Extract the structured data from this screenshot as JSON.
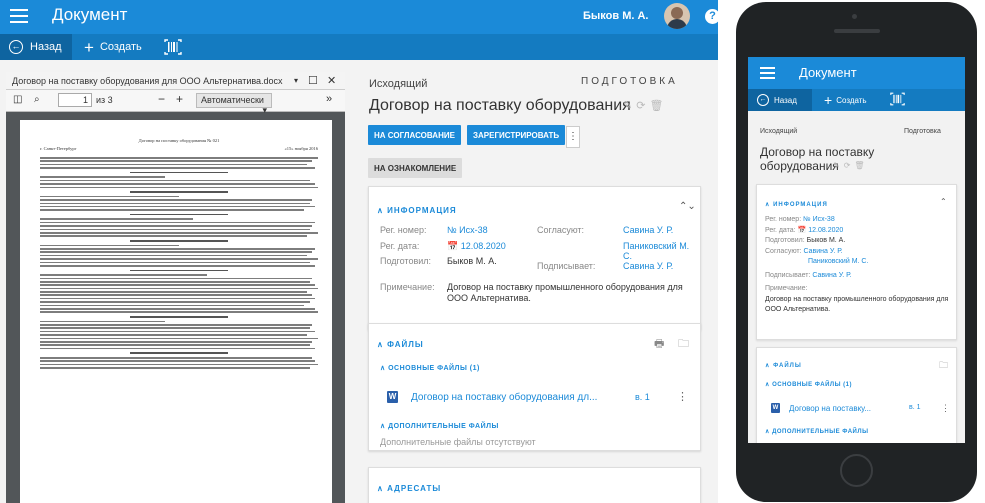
{
  "header": {
    "app_title": "Документ",
    "user_name": "Быков М. А.",
    "help_label": "?"
  },
  "toolbar": {
    "back_label": "Назад",
    "create_label": "Создать"
  },
  "viewer": {
    "file_name": "Договор на поставку оборудования для ООО Альтернатива.docx",
    "page_current": "1",
    "page_total_label": "из 3",
    "zoom_label": "Автоматически",
    "page_heading": "Договор на поставку оборудования № 021",
    "page_city": "г. Санкт-Петербург",
    "page_date": "«15» ноября 2016"
  },
  "document": {
    "subtitle_left": "Исходящий",
    "status": "ПОДГОТОВКА",
    "title": "Договор на поставку оборудования",
    "actions": {
      "approve": "НА СОГЛАСОВАНИЕ",
      "register": "ЗАРЕГИСТРИРОВАТЬ",
      "review": "НА ОЗНАКОМЛЕНИЕ"
    }
  },
  "info": {
    "section_title": "ИНФОРМАЦИЯ",
    "reg_number_label": "Рег. номер:",
    "reg_number_value": "№ Исх-38",
    "reg_date_label": "Рег. дата:",
    "reg_date_value": "12.08.2020",
    "prepared_label": "Подготовил:",
    "prepared_value": "Быков М. А.",
    "approvers_label": "Согласуют:",
    "approvers": [
      "Савина У. Р.",
      "Паниковский М. С."
    ],
    "signer_label": "Подписывает:",
    "signer_value": "Савина У. Р.",
    "note_label": "Примечание:",
    "note_value": "Договор на поставку промышленного оборудования для ООО Альтернатива."
  },
  "files": {
    "section_title": "ФАЙЛЫ",
    "main_title": "ОСНОВНЫЕ ФАЙЛЫ (1)",
    "file_name": "Договор на поставку оборудования дл...",
    "file_name_mobile": "Договор на поставку...",
    "file_version": "в. 1",
    "extra_title": "ДОПОЛНИТЕЛЬНЫЕ ФАЙЛЫ",
    "extra_empty": "Дополнительные файлы отсутствуют"
  },
  "recipients": {
    "section_title": "АДРЕСАТЫ"
  },
  "mobile": {
    "status": "Подготовка"
  },
  "colors": {
    "primary": "#1b8ad8",
    "toolbar": "#147bc1"
  }
}
